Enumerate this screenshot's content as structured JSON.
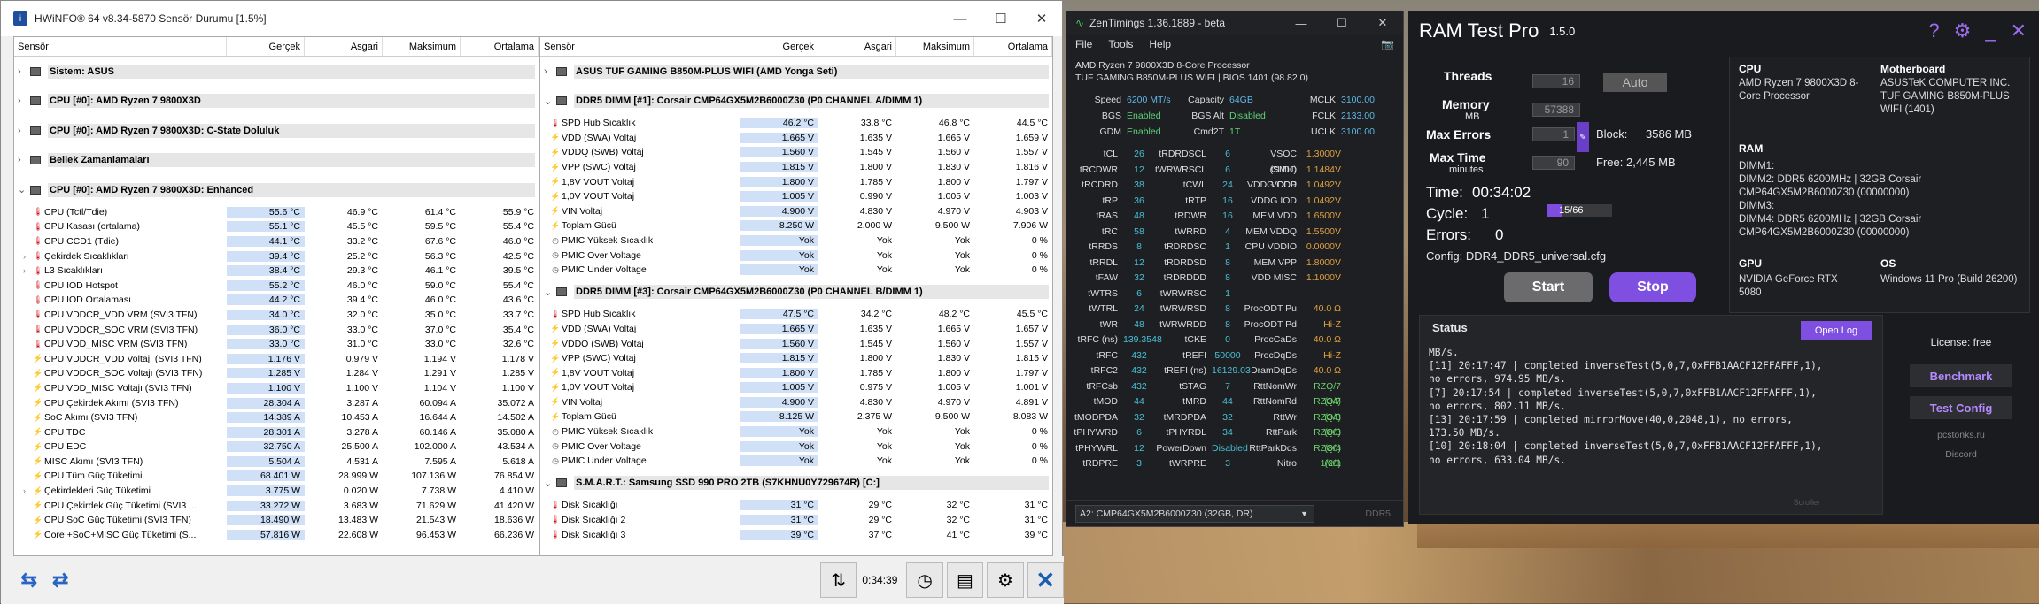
{
  "hwinfo": {
    "title": "HWiNFO® 64 v8.34-5870 Sensör Durumu [1.5%]",
    "headers": [
      "Sensör",
      "Gerçek",
      "Asgari",
      "Maksimum",
      "Ortalama"
    ],
    "left_groups": [
      {
        "label": "Sistem: ASUS",
        "rows": []
      },
      {
        "label": "CPU [#0]: AMD Ryzen 7 9800X3D",
        "rows": []
      },
      {
        "label": "CPU [#0]: AMD Ryzen 7 9800X3D: C-State Doluluk",
        "rows": []
      },
      {
        "label": "Bellek Zamanlamaları",
        "rows": []
      },
      {
        "label": "CPU [#0]: AMD Ryzen 7 9800X3D: Enhanced",
        "rows": []
      }
    ],
    "left_rows": [
      {
        "icon": "t",
        "name": "CPU (Tctl/Tdie)",
        "cur": "55.6 °C",
        "min": "46.9 °C",
        "max": "61.4 °C",
        "avg": "55.9 °C"
      },
      {
        "icon": "t",
        "name": "CPU Kasası (ortalama)",
        "cur": "55.1 °C",
        "min": "45.5 °C",
        "max": "59.5 °C",
        "avg": "55.4 °C"
      },
      {
        "icon": "t",
        "name": "CPU CCD1 (Tdie)",
        "cur": "44.1 °C",
        "min": "33.2 °C",
        "max": "67.6 °C",
        "avg": "46.0 °C"
      },
      {
        "icon": "t",
        "name": "Çekirdek Sıcaklıkları",
        "cur": "39.4 °C",
        "min": "25.2 °C",
        "max": "56.3 °C",
        "avg": "42.5 °C",
        "sub": true
      },
      {
        "icon": "t",
        "name": "L3 Sıcaklıkları",
        "cur": "38.4 °C",
        "min": "29.3 °C",
        "max": "46.1 °C",
        "avg": "39.5 °C",
        "sub": true
      },
      {
        "icon": "t",
        "name": "CPU IOD Hotspot",
        "cur": "55.2 °C",
        "min": "46.0 °C",
        "max": "59.0 °C",
        "avg": "55.4 °C"
      },
      {
        "icon": "t",
        "name": "CPU IOD Ortalaması",
        "cur": "44.2 °C",
        "min": "39.4 °C",
        "max": "46.0 °C",
        "avg": "43.6 °C"
      },
      {
        "icon": "t",
        "name": "CPU VDDCR_VDD VRM (SVI3 TFN)",
        "cur": "34.0 °C",
        "min": "32.0 °C",
        "max": "35.0 °C",
        "avg": "33.7 °C"
      },
      {
        "icon": "t",
        "name": "CPU VDDCR_SOC VRM (SVI3 TFN)",
        "cur": "36.0 °C",
        "min": "33.0 °C",
        "max": "37.0 °C",
        "avg": "35.4 °C"
      },
      {
        "icon": "t",
        "name": "CPU VDD_MISC VRM (SVI3 TFN)",
        "cur": "33.0 °C",
        "min": "31.0 °C",
        "max": "33.0 °C",
        "avg": "32.6 °C"
      },
      {
        "icon": "v",
        "name": "CPU VDDCR_VDD Voltajı (SVI3 TFN)",
        "cur": "1.176 V",
        "min": "0.979 V",
        "max": "1.194 V",
        "avg": "1.178 V"
      },
      {
        "icon": "v",
        "name": "CPU VDDCR_SOC Voltajı (SVI3 TFN)",
        "cur": "1.285 V",
        "min": "1.284 V",
        "max": "1.291 V",
        "avg": "1.285 V"
      },
      {
        "icon": "v",
        "name": "CPU VDD_MISC Voltajı (SVI3 TFN)",
        "cur": "1.100 V",
        "min": "1.100 V",
        "max": "1.104 V",
        "avg": "1.100 V"
      },
      {
        "icon": "v",
        "name": "CPU Çekirdek Akımı (SVI3 TFN)",
        "cur": "28.304 A",
        "min": "3.287 A",
        "max": "60.094 A",
        "avg": "35.072 A"
      },
      {
        "icon": "v",
        "name": "SoC Akımı (SVI3 TFN)",
        "cur": "14.389 A",
        "min": "10.453 A",
        "max": "16.644 A",
        "avg": "14.502 A"
      },
      {
        "icon": "v",
        "name": "CPU TDC",
        "cur": "28.301 A",
        "min": "3.278 A",
        "max": "60.146 A",
        "avg": "35.080 A"
      },
      {
        "icon": "v",
        "name": "CPU EDC",
        "cur": "32.750 A",
        "min": "25.500 A",
        "max": "102.000 A",
        "avg": "43.534 A"
      },
      {
        "icon": "v",
        "name": "MISC Akımı (SVI3 TFN)",
        "cur": "5.504 A",
        "min": "4.531 A",
        "max": "7.595 A",
        "avg": "5.618 A"
      },
      {
        "icon": "v",
        "name": "CPU Tüm Güç Tüketimi",
        "cur": "68.401 W",
        "min": "28.999 W",
        "max": "107.136 W",
        "avg": "76.854 W"
      },
      {
        "icon": "v",
        "name": "Çekirdekleri Güç Tüketimi",
        "cur": "3.775 W",
        "min": "0.020 W",
        "max": "7.738 W",
        "avg": "4.410 W",
        "sub": true
      },
      {
        "icon": "v",
        "name": "CPU Çekirdek Güç Tüketimi (SVI3 ...",
        "cur": "33.272 W",
        "min": "3.683 W",
        "max": "71.629 W",
        "avg": "41.420 W"
      },
      {
        "icon": "v",
        "name": "CPU SoC Güç Tüketimi (SVI3 TFN)",
        "cur": "18.490 W",
        "min": "13.483 W",
        "max": "21.543 W",
        "avg": "18.636 W"
      },
      {
        "icon": "v",
        "name": "Core +SoC+MISC Güç Tüketimi (S...",
        "cur": "57.816 W",
        "min": "22.608 W",
        "max": "96.453 W",
        "avg": "66.236 W"
      }
    ],
    "right_groups": [
      {
        "label": "ASUS TUF GAMING B850M-PLUS WIFI (AMD Yonga Seti)"
      },
      {
        "label": "DDR5 DIMM [#1]: Corsair CMP64GX5M2B6000Z30 (P0 CHANNEL A/DIMM 1)"
      },
      {
        "label": "DDR5 DIMM [#3]: Corsair CMP64GX5M2B6000Z30 (P0 CHANNEL B/DIMM 1)"
      },
      {
        "label": "S.M.A.R.T.: Samsung SSD 990 PRO 2TB (S7KHNU0Y729674R) [C:]"
      }
    ],
    "dimm1_rows": [
      {
        "icon": "t",
        "name": "SPD Hub Sıcaklık",
        "cur": "46.2 °C",
        "min": "33.8 °C",
        "max": "46.8 °C",
        "avg": "44.5 °C"
      },
      {
        "icon": "v",
        "name": "VDD (SWA) Voltaj",
        "cur": "1.665 V",
        "min": "1.635 V",
        "max": "1.665 V",
        "avg": "1.659 V"
      },
      {
        "icon": "v",
        "name": "VDDQ (SWB) Voltaj",
        "cur": "1.560 V",
        "min": "1.545 V",
        "max": "1.560 V",
        "avg": "1.557 V"
      },
      {
        "icon": "v",
        "name": "VPP (SWC) Voltaj",
        "cur": "1.815 V",
        "min": "1.800 V",
        "max": "1.830 V",
        "avg": "1.816 V"
      },
      {
        "icon": "v",
        "name": "1,8V VOUT Voltaj",
        "cur": "1.800 V",
        "min": "1.785 V",
        "max": "1.800 V",
        "avg": "1.797 V"
      },
      {
        "icon": "v",
        "name": "1,0V VOUT Voltaj",
        "cur": "1.005 V",
        "min": "0.990 V",
        "max": "1.005 V",
        "avg": "1.003 V"
      },
      {
        "icon": "v",
        "name": "VIN Voltaj",
        "cur": "4.900 V",
        "min": "4.830 V",
        "max": "4.970 V",
        "avg": "4.903 V"
      },
      {
        "icon": "v",
        "name": "Toplam Gücü",
        "cur": "8.250 W",
        "min": "2.000 W",
        "max": "9.500 W",
        "avg": "7.906 W"
      },
      {
        "icon": "c",
        "name": "PMIC Yüksek Sıcaklık",
        "cur": "Yok",
        "min": "Yok",
        "max": "Yok",
        "avg": "0 %"
      },
      {
        "icon": "c",
        "name": "PMIC Over Voltage",
        "cur": "Yok",
        "min": "Yok",
        "max": "Yok",
        "avg": "0 %"
      },
      {
        "icon": "c",
        "name": "PMIC Under Voltage",
        "cur": "Yok",
        "min": "Yok",
        "max": "Yok",
        "avg": "0 %"
      }
    ],
    "dimm3_rows": [
      {
        "icon": "t",
        "name": "SPD Hub Sıcaklık",
        "cur": "47.5 °C",
        "min": "34.2 °C",
        "max": "48.2 °C",
        "avg": "45.5 °C"
      },
      {
        "icon": "v",
        "name": "VDD (SWA) Voltaj",
        "cur": "1.665 V",
        "min": "1.635 V",
        "max": "1.665 V",
        "avg": "1.657 V"
      },
      {
        "icon": "v",
        "name": "VDDQ (SWB) Voltaj",
        "cur": "1.560 V",
        "min": "1.545 V",
        "max": "1.560 V",
        "avg": "1.557 V"
      },
      {
        "icon": "v",
        "name": "VPP (SWC) Voltaj",
        "cur": "1.815 V",
        "min": "1.800 V",
        "max": "1.830 V",
        "avg": "1.815 V"
      },
      {
        "icon": "v",
        "name": "1,8V VOUT Voltaj",
        "cur": "1.800 V",
        "min": "1.785 V",
        "max": "1.800 V",
        "avg": "1.797 V"
      },
      {
        "icon": "v",
        "name": "1,0V VOUT Voltaj",
        "cur": "1.005 V",
        "min": "0.975 V",
        "max": "1.005 V",
        "avg": "1.001 V"
      },
      {
        "icon": "v",
        "name": "VIN Voltaj",
        "cur": "4.900 V",
        "min": "4.830 V",
        "max": "4.970 V",
        "avg": "4.891 V"
      },
      {
        "icon": "v",
        "name": "Toplam Gücü",
        "cur": "8.125 W",
        "min": "2.375 W",
        "max": "9.500 W",
        "avg": "8.083 W"
      },
      {
        "icon": "c",
        "name": "PMIC Yüksek Sıcaklık",
        "cur": "Yok",
        "min": "Yok",
        "max": "Yok",
        "avg": "0 %"
      },
      {
        "icon": "c",
        "name": "PMIC Over Voltage",
        "cur": "Yok",
        "min": "Yok",
        "max": "Yok",
        "avg": "0 %"
      },
      {
        "icon": "c",
        "name": "PMIC Under Voltage",
        "cur": "Yok",
        "min": "Yok",
        "max": "Yok",
        "avg": "0 %"
      }
    ],
    "smart_rows": [
      {
        "icon": "t",
        "name": "Disk Sıcaklığı",
        "cur": "31 °C",
        "min": "29 °C",
        "max": "32 °C",
        "avg": "31 °C"
      },
      {
        "icon": "t",
        "name": "Disk Sıcaklığı 2",
        "cur": "31 °C",
        "min": "29 °C",
        "max": "32 °C",
        "avg": "31 °C"
      },
      {
        "icon": "t",
        "name": "Disk Sıcaklığı 3",
        "cur": "39 °C",
        "min": "37 °C",
        "max": "41 °C",
        "avg": "39 °C"
      }
    ],
    "elapsed": "0:34:39"
  },
  "zentimings": {
    "title": "ZenTimings 1.36.1889 - beta",
    "menu": [
      "File",
      "Tools",
      "Help"
    ],
    "cpu": "AMD Ryzen 7 9800X3D 8-Core Processor",
    "board": "TUF GAMING B850M-PLUS WIFI | BIOS 1401 (98.82.0)",
    "top": [
      [
        "Speed",
        "6200 MT/s",
        "Capacity",
        "64GB",
        "MCLK",
        "3100.00"
      ],
      [
        "BGS",
        "Enabled",
        "BGS Alt",
        "Disabled",
        "FCLK",
        "2133.00"
      ],
      [
        "GDM",
        "Enabled",
        "Cmd2T",
        "1T",
        "UCLK",
        "3100.00"
      ]
    ],
    "timings": [
      [
        "tCL",
        "26",
        "tRDRDSCL",
        "6",
        "VSOC (SMU)",
        "1.3000V"
      ],
      [
        "tRCDWR",
        "12",
        "tWRWRSCL",
        "6",
        "CLDO VDDP",
        "1.1484V"
      ],
      [
        "tRCDRD",
        "38",
        "tCWL",
        "24",
        "VDDG CCD",
        "1.0492V"
      ],
      [
        "tRP",
        "36",
        "tRTP",
        "16",
        "VDDG IOD",
        "1.0492V"
      ],
      [
        "tRAS",
        "48",
        "tRDWR",
        "16",
        "MEM VDD",
        "1.6500V"
      ],
      [
        "tRC",
        "58",
        "tWRRD",
        "4",
        "MEM VDDQ",
        "1.5500V"
      ],
      [
        "tRRDS",
        "8",
        "tRDRDSC",
        "1",
        "CPU VDDIO",
        "0.0000V"
      ],
      [
        "tRRDL",
        "12",
        "tRDRDSD",
        "8",
        "MEM VPP",
        "1.8000V"
      ],
      [
        "tFAW",
        "32",
        "tRDRDDD",
        "8",
        "VDD MISC",
        "1.1000V"
      ],
      [
        "tWTRS",
        "6",
        "tWRWRSC",
        "1",
        "",
        ""
      ],
      [
        "tWTRL",
        "24",
        "tWRWRSD",
        "8",
        "ProcODT Pu",
        "40.0 Ω"
      ],
      [
        "tWR",
        "48",
        "tWRWRDD",
        "8",
        "ProcODT Pd",
        "Hi-Z"
      ],
      [
        "tRFC (ns)",
        "139.3548",
        "tCKE",
        "0",
        "ProcCaDs",
        "40.0 Ω"
      ],
      [
        "tRFC",
        "432",
        "tREFI",
        "50000",
        "ProcDqDs",
        "Hi-Z"
      ],
      [
        "tRFC2",
        "432",
        "tREFI (ns)",
        "16129.03",
        "DramDqDs",
        "40.0 Ω"
      ],
      [
        "tRFCsb",
        "432",
        "tSTAG",
        "7",
        "RttNomWr",
        "RZQ/7 (34)"
      ],
      [
        "tMOD",
        "44",
        "tMRD",
        "44",
        "RttNomRd",
        "RZQ/7 (34)"
      ],
      [
        "tMODPDA",
        "32",
        "tMRDPDA",
        "32",
        "RttWr",
        "RZQ/3 (80)"
      ],
      [
        "tPHYWRD",
        "6",
        "tPHYRDL",
        "34",
        "RttPark",
        "RZQ/3 (80)"
      ],
      [
        "tPHYWRL",
        "12",
        "PowerDown",
        "Disabled",
        "RttParkDqs",
        "RZQ/4 (60)"
      ],
      [
        "tRDPRE",
        "3",
        "tWRPRE",
        "3",
        "Nitro",
        "1/2/1"
      ]
    ],
    "module": "A2: CMP64GX5M2B6000Z30 (32GB, DR)",
    "ddr": "DDR5"
  },
  "ramtest": {
    "title": "RAM Test Pro",
    "version": "1.5.0",
    "threads_label": "Threads",
    "threads": "16",
    "auto": "Auto",
    "memory_label": "Memory",
    "memory_unit": "MB",
    "memory": "57388",
    "maxerr_label": "Max Errors",
    "maxerr": "1",
    "maxtime_label": "Max Time",
    "maxtime_unit": "minutes",
    "maxtime": "90",
    "block_label": "Block:",
    "block": "3586 MB",
    "free_label": "Free:",
    "free": "2,445 MB",
    "time_label": "Time:",
    "time": "00:34:02",
    "cycle_label": "Cycle:",
    "cycle": "1",
    "progress_text": "15/66",
    "progress": 0.227,
    "errors_label": "Errors:",
    "errors": "0",
    "config_label": "Config:",
    "config": "DDR4_DDR5_universal.cfg",
    "start": "Start",
    "stop": "Stop",
    "sys": {
      "cpu_h": "CPU",
      "cpu": "AMD Ryzen 7 9800X3D 8-Core Processor",
      "mb_h": "Motherboard",
      "mb": "ASUSTeK COMPUTER INC. TUF GAMING B850M-PLUS WIFI (1401)",
      "ram_h": "RAM",
      "ram": [
        "DIMM1:",
        "DIMM2: DDR5 6200MHz | 32GB Corsair",
        "CMP64GX5M2B6000Z30 (00000000)",
        "DIMM3:",
        "DIMM4: DDR5 6200MHz | 32GB Corsair",
        "CMP64GX5M2B6000Z30 (00000000)"
      ],
      "gpu_h": "GPU",
      "gpu": "NVIDIA GeForce RTX 5080",
      "os_h": "OS",
      "os": "Windows 11 Pro (Build 26200)"
    },
    "status_h": "Status",
    "open_log": "Open Log",
    "log": "MB/s.\n[11] 20:17:47 | completed inverseTest(5,0,7,0xFFB1AACF12FFAFFF,1),\nno errors, 974.95 MB/s.\n[7] 20:17:54 | completed inverseTest(5,0,7,0xFFB1AACF12FFAFFF,1),\nno errors, 802.11 MB/s.\n[13] 20:17:59 | completed mirrorMove(40,0,2048,1), no errors,\n173.50 MB/s.\n[10] 20:18:04 | completed inverseTest(5,0,7,0xFFB1AACF12FFAFFF,1),\nno errors, 633.04 MB/s.",
    "scroll": "Scroller",
    "license": "License: free",
    "benchmark": "Benchmark",
    "testconfig": "Test Config",
    "site": "pcstonks.ru",
    "discord": "Discord"
  }
}
